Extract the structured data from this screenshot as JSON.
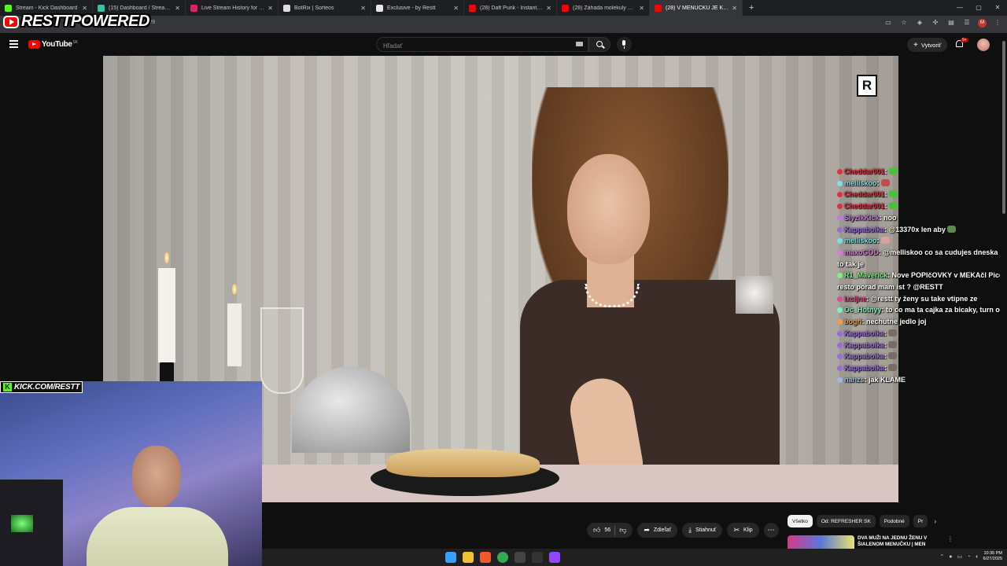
{
  "browser": {
    "tabs": [
      {
        "label": "Stream - Kick Dashboard",
        "icon": "kick-icon",
        "color": "#53fc18"
      },
      {
        "label": "(15) Dashboard / Streamlabs",
        "icon": "streamlabs-icon",
        "color": "#31c3a2"
      },
      {
        "label": "Live Stream History for Blerp St",
        "icon": "blerp-icon",
        "color": "#e0206b"
      },
      {
        "label": "BotRix | Sorteos",
        "icon": "botrix-icon",
        "color": "#dddddd"
      },
      {
        "label": "Exclusive - by Restt",
        "icon": "restt-icon",
        "color": "#e8e8e8"
      },
      {
        "label": "(28) Daft Punk - Instant Crush",
        "icon": "youtube-icon",
        "color": "#ff0000"
      },
      {
        "label": "(28) Záhada molekuly DMT a p",
        "icon": "youtube-icon",
        "color": "#ff0000"
      },
      {
        "label": "(28) V MENUČKU JE KONE",
        "icon": "youtube-icon",
        "color": "#ff0000"
      }
    ],
    "url_fragment": "eMNW8"
  },
  "overlay": {
    "brand": "RESTTPOWERED",
    "kick_handle": "KICK.COM/RESTT",
    "video_logo": "R"
  },
  "youtube": {
    "logo_text": "YouTube",
    "country_code": "SK",
    "search_placeholder": "Hľadať",
    "create_label": "Vytvoriť",
    "notif_count": "9+",
    "actions": {
      "likes": "56",
      "share": "Zdieľať",
      "download": "Stiahnuť",
      "clip": "Klip"
    },
    "chips": [
      "Všetko",
      "Od: REFRESHER SK",
      "Podobné",
      "Pr"
    ],
    "recommendation_title": "DVA MUŽI NA JEDNU ŽENU V ŠIALENOM MENUČKU | MEN"
  },
  "chat": [
    {
      "user": "Cheddar001",
      "color": "#e0303a",
      "text": ":",
      "emote": "#4bbf3a"
    },
    {
      "user": "melliskoo",
      "color": "#7fe0e0",
      "text": ":",
      "emote": "#c24c4c"
    },
    {
      "user": "Cheddar001",
      "color": "#e0303a",
      "text": ":",
      "emote": "#4bbf3a"
    },
    {
      "user": "Cheddar001",
      "color": "#e0303a",
      "text": ":",
      "emote": "#4bbf3a"
    },
    {
      "user": "SlyzikKick",
      "color": "#c07ad8",
      "text": ": noo",
      "emote": ""
    },
    {
      "user": "Kappaboika",
      "color": "#9a6cd8",
      "text": ": @13370x len aby",
      "emote": "#5b8a4a"
    },
    {
      "user": "melliskoo",
      "color": "#7fe0e0",
      "text": ":",
      "emote": "#d8a0a0"
    },
    {
      "user": "maxoGOD",
      "color": "#d87ad8",
      "text": ": @melliskoo co sa cudujes dneska to tak je",
      "emote": ""
    },
    {
      "user": "R1_Maverick",
      "color": "#7ef07e",
      "text": ": Nove POPIčOVKY v MEKAčI Pice resto porad mam ist ? @RESTT",
      "emote": ""
    },
    {
      "user": "Ixcijne",
      "color": "#e04b8a",
      "text": ": @restt ty ženy su take vtipne ze",
      "emote": ""
    },
    {
      "user": "Oc_Hotnyy",
      "color": "#7ef0c0",
      "text": ": to co ma ta cajka za bicaky, turn off",
      "emote": ""
    },
    {
      "user": "bogri",
      "color": "#f0a040",
      "text": ": nechutne jedlo joj",
      "emote": ""
    },
    {
      "user": "Kappaboika",
      "color": "#9a6cd8",
      "text": ":",
      "emote": "#7a6a6a"
    },
    {
      "user": "Kappaboika",
      "color": "#9a6cd8",
      "text": ":",
      "emote": "#7a6a6a"
    },
    {
      "user": "Kappaboika",
      "color": "#9a6cd8",
      "text": ":",
      "emote": "#7a6a6a"
    },
    {
      "user": "Kappaboika",
      "color": "#9a6cd8",
      "text": ":",
      "emote": "#7a6a6a"
    },
    {
      "user": "nahzs",
      "color": "#9ab8e0",
      "text": ": jak KLAME",
      "emote": ""
    }
  ],
  "taskbar": {
    "time": "10:35 PM",
    "date": "6/27/2025",
    "apps": [
      {
        "name": "windows-start-icon",
        "color": "#3aa0ff"
      },
      {
        "name": "file-explorer-icon",
        "color": "#f2c230"
      },
      {
        "name": "brave-icon",
        "color": "#f05a28"
      },
      {
        "name": "chrome-icon",
        "color": "#35a853"
      },
      {
        "name": "terminal-icon",
        "color": "#444444"
      },
      {
        "name": "obs-icon",
        "color": "#333333"
      },
      {
        "name": "twitch-icon",
        "color": "#9146ff"
      }
    ]
  }
}
